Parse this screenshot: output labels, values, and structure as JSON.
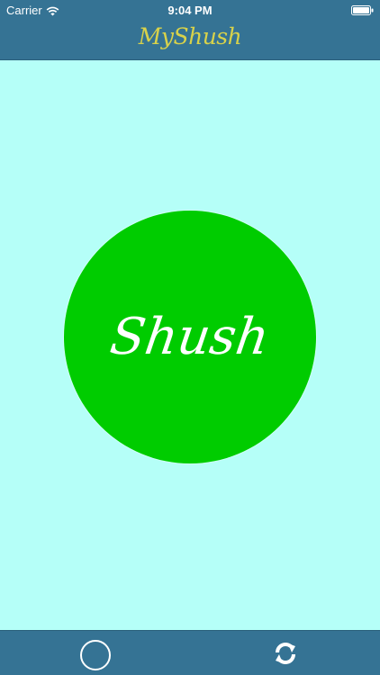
{
  "status_bar": {
    "carrier": "Carrier",
    "time": "9:04 PM"
  },
  "header": {
    "title": "MyShush"
  },
  "main": {
    "shush_button_label": "Shush"
  },
  "icons": {
    "wifi": "wifi-icon",
    "battery": "battery-icon",
    "circle": "circle-icon",
    "refresh": "refresh-icon"
  },
  "colors": {
    "bar_background": "#357394",
    "screen_background": "#b5fff8",
    "button_green": "#00cc00",
    "title_yellow": "#d8d24a"
  }
}
